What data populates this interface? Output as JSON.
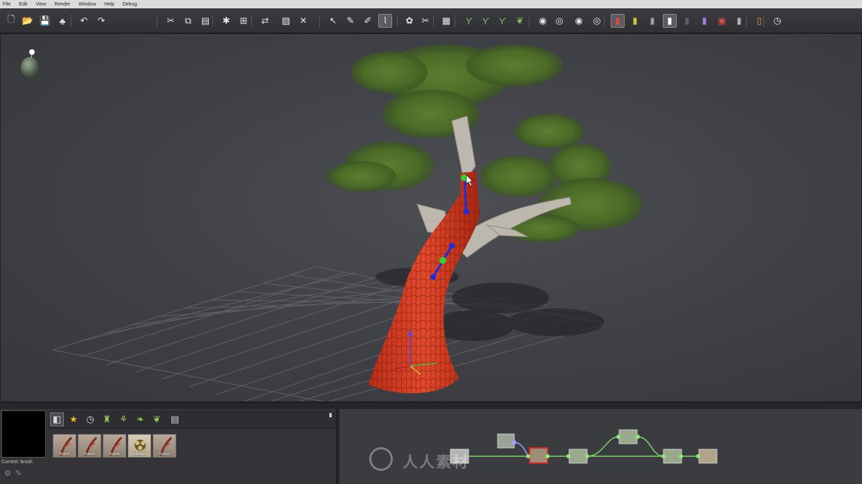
{
  "menu": [
    "File",
    "Edit",
    "View",
    "Render",
    "Window",
    "Help",
    "Debug"
  ],
  "toolbar": [
    {
      "name": "new-icon",
      "glyph": "🗋"
    },
    {
      "name": "open-icon",
      "glyph": "📂"
    },
    {
      "name": "save-icon",
      "glyph": "💾"
    },
    {
      "name": "export-tree-icon",
      "glyph": "♣"
    },
    {
      "name": "undo-icon",
      "glyph": "↶"
    },
    {
      "name": "redo-icon",
      "glyph": "↷"
    },
    {
      "name": "cut-icon",
      "glyph": "✂"
    },
    {
      "name": "copy-icon",
      "glyph": "⧉"
    },
    {
      "name": "paste-icon",
      "glyph": "▤"
    },
    {
      "name": "select-node-icon",
      "glyph": "✱"
    },
    {
      "name": "select-all-icon",
      "glyph": "⊞"
    },
    {
      "name": "swap-icon",
      "glyph": "⇄"
    },
    {
      "name": "disable-icon",
      "glyph": "▨"
    },
    {
      "name": "delete-icon",
      "glyph": "✕"
    },
    {
      "name": "node-edit-icon",
      "glyph": "↖"
    },
    {
      "name": "pen-icon",
      "glyph": "✎"
    },
    {
      "name": "pencil-icon",
      "glyph": "✐"
    },
    {
      "name": "spine-edit-icon",
      "glyph": "⌇"
    },
    {
      "name": "leaf-paint-icon",
      "glyph": "✿"
    },
    {
      "name": "prune-icon",
      "glyph": "✂"
    },
    {
      "name": "grid-icon",
      "glyph": "▦"
    },
    {
      "name": "branch-tool-1-icon",
      "glyph": "ϒ"
    },
    {
      "name": "branch-tool-2-icon",
      "glyph": "ϒ"
    },
    {
      "name": "branch-tool-3-icon",
      "glyph": "ϒ"
    },
    {
      "name": "leaf-tool-icon",
      "glyph": "❦"
    },
    {
      "name": "camera-1-icon",
      "glyph": "◉"
    },
    {
      "name": "camera-2-icon",
      "glyph": "◎"
    },
    {
      "name": "camera-3-icon",
      "glyph": "◉"
    },
    {
      "name": "camera-4-icon",
      "glyph": "◎"
    },
    {
      "name": "material-red-icon",
      "glyph": "▮"
    },
    {
      "name": "material-yellow-icon",
      "glyph": "▮"
    },
    {
      "name": "material-gray-icon",
      "glyph": "▮"
    },
    {
      "name": "material-white-icon",
      "glyph": "▮"
    },
    {
      "name": "material-dark-icon",
      "glyph": "▮"
    },
    {
      "name": "material-purple-icon",
      "glyph": "▮"
    },
    {
      "name": "material-wind-icon",
      "glyph": "▣"
    },
    {
      "name": "material-stack-icon",
      "glyph": "▮"
    },
    {
      "name": "ruler-icon",
      "glyph": "▯"
    },
    {
      "name": "compass-icon",
      "glyph": "◷"
    }
  ],
  "bottom": {
    "current_brush": "Current: brush",
    "categories": [
      {
        "name": "category-brushes-icon",
        "glyph": "◧"
      },
      {
        "name": "category-favorites-icon",
        "glyph": "★"
      },
      {
        "name": "category-recent-icon",
        "glyph": "◷"
      },
      {
        "name": "category-trunk-icon",
        "glyph": "♜"
      },
      {
        "name": "category-branch-icon",
        "glyph": "⚘"
      },
      {
        "name": "category-fronds-icon",
        "glyph": "❧"
      },
      {
        "name": "category-leaves-icon",
        "glyph": "❦"
      },
      {
        "name": "category-billboard-icon",
        "glyph": "▤"
      }
    ],
    "brushes": [
      {
        "label": "Branch"
      },
      {
        "label": "Branch"
      },
      {
        "label": "Branch"
      },
      {
        "label": "Billboard"
      },
      {
        "label": "Branch"
      }
    ]
  },
  "watermark": "人人素材"
}
